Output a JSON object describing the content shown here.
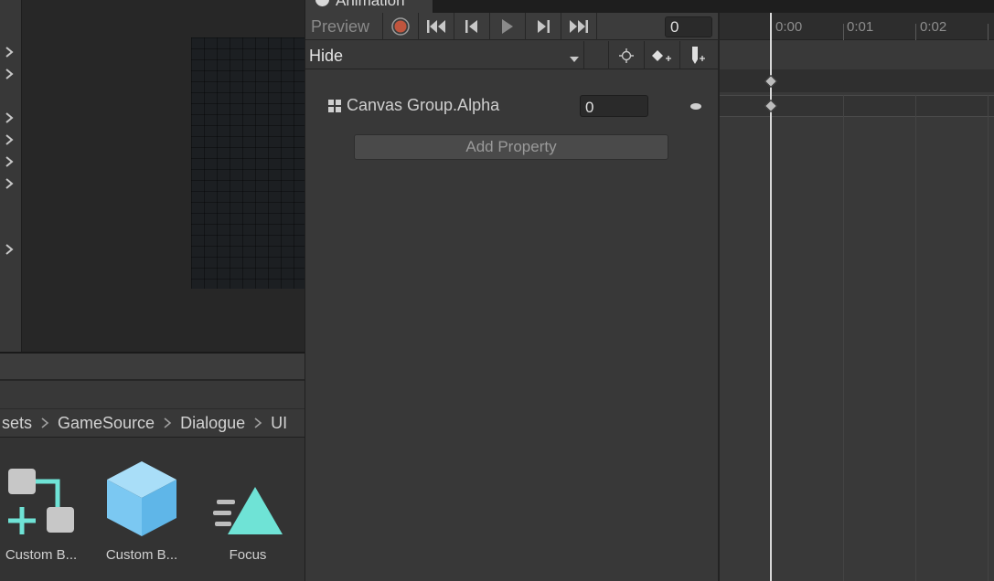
{
  "animation_window": {
    "tab_title": "Animation",
    "preview_label": "Preview",
    "frame_value": "0",
    "clip_name": "Hide",
    "property": {
      "name": "Canvas Group.Alpha",
      "value": "0"
    },
    "add_property_label": "Add Property",
    "timeline_ticks": [
      "0:00",
      "0:01",
      "0:02"
    ]
  },
  "project": {
    "breadcrumb": [
      "sets",
      "GameSource",
      "Dialogue",
      "UI"
    ],
    "assets": [
      {
        "label": "Custom B...",
        "icon": "script-graph-icon"
      },
      {
        "label": "Custom B...",
        "icon": "cube-prefab-icon"
      },
      {
        "label": "Focus",
        "icon": "focus-effect-icon"
      }
    ]
  },
  "colors": {
    "record_red": "#c0553e",
    "asset_cyan": "#6fe3d6",
    "asset_blue": "#7bc8f2"
  }
}
